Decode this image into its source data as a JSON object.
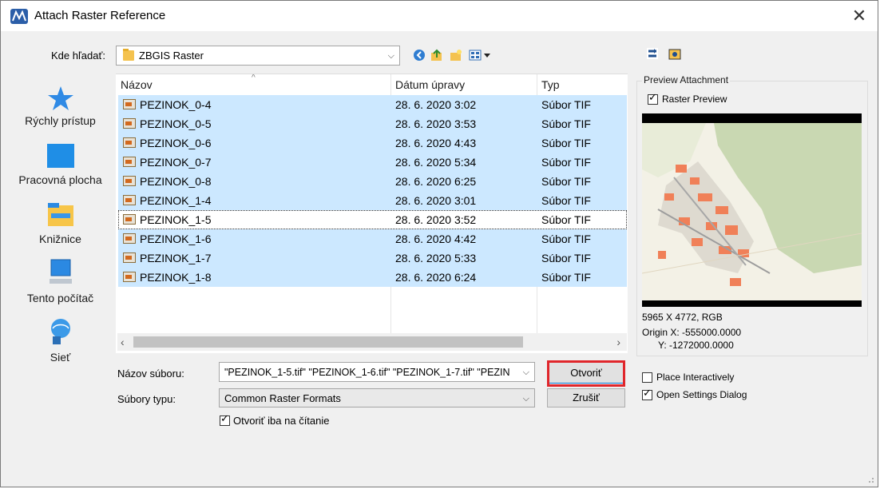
{
  "window": {
    "title": "Attach Raster Reference",
    "close_glyph": "✕"
  },
  "lookin": {
    "label": "Kde hľadať:",
    "value": "ZBGIS Raster",
    "arrow": "⌵"
  },
  "toolbar_right_icons": [
    "refresh-icon",
    "new-folder-icon"
  ],
  "sidebar": {
    "items": [
      {
        "label": "Rýchly prístup",
        "icon": "star-icon"
      },
      {
        "label": "Pracovná plocha",
        "icon": "desktop-icon"
      },
      {
        "label": "Knižnice",
        "icon": "libraries-icon"
      },
      {
        "label": "Tento počítač",
        "icon": "computer-icon"
      },
      {
        "label": "Sieť",
        "icon": "network-icon"
      }
    ]
  },
  "filelist": {
    "columns": {
      "name": "Názov",
      "date": "Dátum úpravy",
      "type": "Typ"
    },
    "rows": [
      {
        "name": "PEZINOK_0-4",
        "date": "28. 6. 2020 3:02",
        "type": "Súbor TIF"
      },
      {
        "name": "PEZINOK_0-5",
        "date": "28. 6. 2020 3:53",
        "type": "Súbor TIF"
      },
      {
        "name": "PEZINOK_0-6",
        "date": "28. 6. 2020 4:43",
        "type": "Súbor TIF"
      },
      {
        "name": "PEZINOK_0-7",
        "date": "28. 6. 2020 5:34",
        "type": "Súbor TIF"
      },
      {
        "name": "PEZINOK_0-8",
        "date": "28. 6. 2020 6:25",
        "type": "Súbor TIF"
      },
      {
        "name": "PEZINOK_1-4",
        "date": "28. 6. 2020 3:01",
        "type": "Súbor TIF"
      },
      {
        "name": "PEZINOK_1-5",
        "date": "28. 6. 2020 3:52",
        "type": "Súbor TIF"
      },
      {
        "name": "PEZINOK_1-6",
        "date": "28. 6. 2020 4:42",
        "type": "Súbor TIF"
      },
      {
        "name": "PEZINOK_1-7",
        "date": "28. 6. 2020 5:33",
        "type": "Súbor TIF"
      },
      {
        "name": "PEZINOK_1-8",
        "date": "28. 6. 2020 6:24",
        "type": "Súbor TIF"
      }
    ]
  },
  "form": {
    "filename_label": "Názov súboru:",
    "filename_value": "\"PEZINOK_1-5.tif\" \"PEZINOK_1-6.tif\" \"PEZINOK_1-7.tif\" \"PEZIN",
    "filetype_label": "Súbory typu:",
    "filetype_value": "Common Raster Formats",
    "readonly_label": "Otvoriť iba na čítanie",
    "readonly_checked": true,
    "open_button": "Otvoriť",
    "cancel_button": "Zrušiť"
  },
  "preview": {
    "group_title": "Preview Attachment",
    "raster_preview_label": "Raster Preview",
    "raster_preview_checked": true,
    "dims": "5965 X 4772, RGB",
    "origin_x": "Origin X: -555000.0000",
    "origin_y": "Y: -1272000.0000",
    "place_interactively_label": "Place Interactively",
    "place_interactively_checked": false,
    "open_settings_label": "Open Settings Dialog",
    "open_settings_checked": true
  },
  "colors": {
    "selection": "#cce8ff",
    "highlight_box": "#e0262b",
    "accent": "#0078d7"
  }
}
